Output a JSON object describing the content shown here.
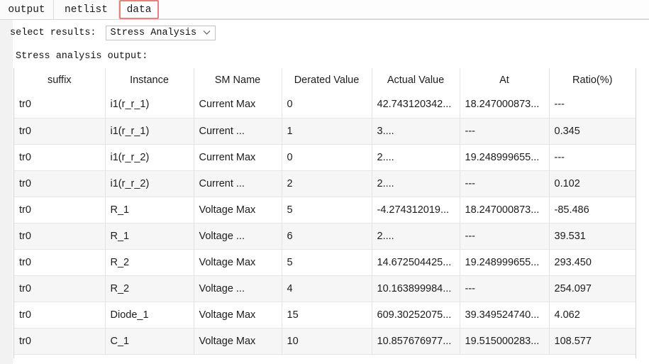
{
  "tabs": [
    {
      "label": "output",
      "active": false
    },
    {
      "label": "netlist",
      "active": false
    },
    {
      "label": "data",
      "active": true
    }
  ],
  "controls": {
    "select_label": "select results:",
    "results_dropdown_value": "Stress Analysis",
    "caret_icon": "chevron-down-icon"
  },
  "section": {
    "caption": "Stress analysis output:"
  },
  "table": {
    "columns": [
      "suffix",
      "Instance",
      "SM Name",
      "Derated Value",
      "Actual Value",
      "At",
      "Ratio(%)"
    ],
    "rows": [
      [
        "tr0",
        "i1(r_r_1)",
        "Current Max",
        "0",
        "42.743120342...",
        "18.247000873...",
        "---"
      ],
      [
        "tr0",
        "i1(r_r_1)",
        "Current ...",
        "1",
        "3....",
        "---",
        "0.345"
      ],
      [
        "tr0",
        "i1(r_r_2)",
        "Current Max",
        "0",
        "2....",
        "19.248999655...",
        "---"
      ],
      [
        "tr0",
        "i1(r_r_2)",
        "Current ...",
        "2",
        "2....",
        "---",
        "0.102"
      ],
      [
        "tr0",
        "R_1",
        "Voltage Max",
        "5",
        "-4.274312019...",
        "18.247000873...",
        "-85.486"
      ],
      [
        "tr0",
        "R_1",
        "Voltage ...",
        "6",
        "2....",
        "---",
        "39.531"
      ],
      [
        "tr0",
        "R_2",
        "Voltage Max",
        "5",
        "14.672504425...",
        "19.248999655...",
        "293.450"
      ],
      [
        "tr0",
        "R_2",
        "Voltage ...",
        "4",
        "10.163899984...",
        "---",
        "254.097"
      ],
      [
        "tr0",
        "Diode_1",
        "Voltage Max",
        "15",
        "609.30252075...",
        "39.349524740...",
        "4.062"
      ],
      [
        "tr0",
        "C_1",
        "Voltage Max",
        "10",
        "10.857676977...",
        "19.515000283...",
        "108.577"
      ]
    ]
  },
  "colors": {
    "active_tab_outline": "#e8807f",
    "page_background": "#ffffff",
    "gutter": "#f2f2f2",
    "row_alt": "#f6f6f6",
    "grid_line": "#e3e3e3"
  }
}
